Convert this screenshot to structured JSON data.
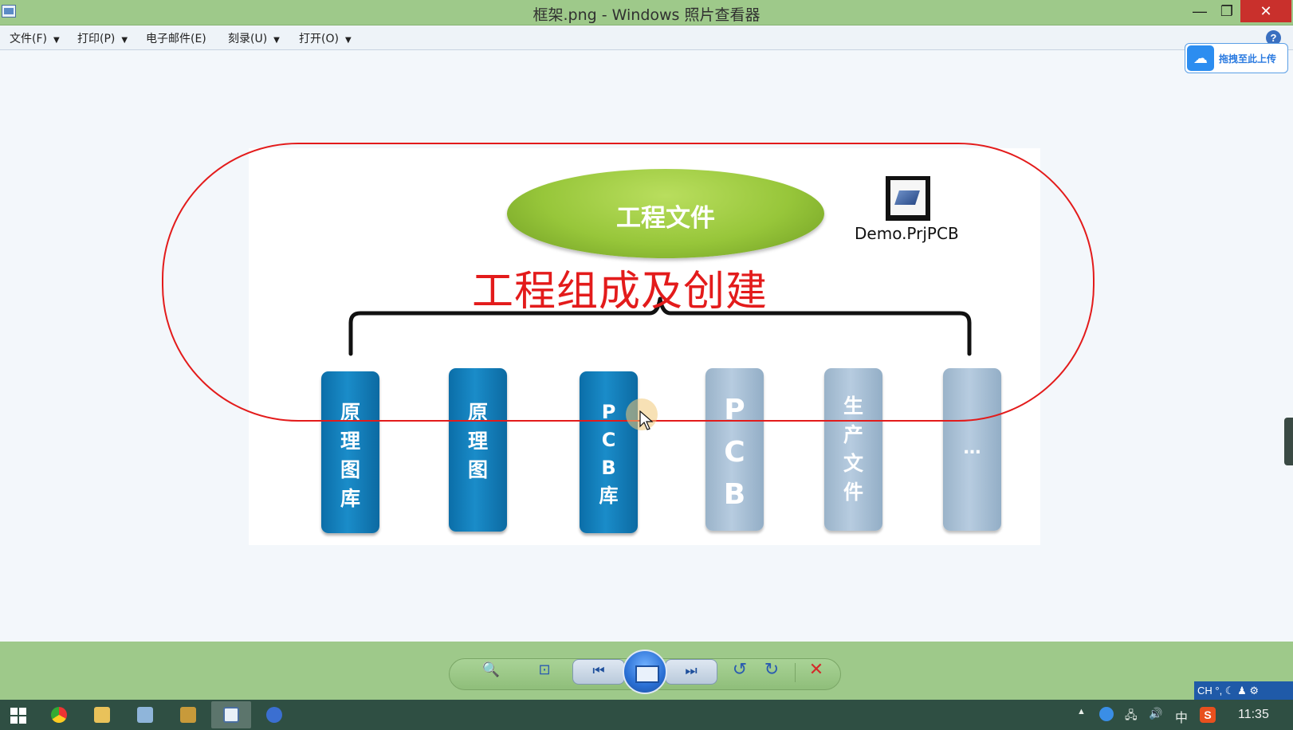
{
  "window": {
    "title": "框架.png - Windows 照片查看器",
    "minimize": "—",
    "maximize": "❐",
    "close": "✕"
  },
  "menu": {
    "file": "文件(F)",
    "print": "打印(P)",
    "email": "电子邮件(E)",
    "burn": "刻录(U)",
    "open": "打开(O)",
    "dropdown_arrow": "▼",
    "help": "?"
  },
  "upload_widget": {
    "icon": "cloud-icon",
    "label": "拖拽至此上传"
  },
  "slide": {
    "root_label": "工程文件",
    "file_label": "Demo.PrjPCB",
    "annotation": "工程组成及创建",
    "bars": [
      {
        "text": "原理图库",
        "style": "dark"
      },
      {
        "text": "原理图",
        "style": "dark"
      },
      {
        "text": "PCB库",
        "style": "dark"
      },
      {
        "text": "PCB",
        "style": "light"
      },
      {
        "text": "生产文件",
        "style": "light"
      },
      {
        "text": "…",
        "style": "light"
      }
    ]
  },
  "controls": {
    "zoom": "🔍",
    "fit": "⊡",
    "prev": "⏮",
    "next": "⏭",
    "rotate_ccw": "↺",
    "rotate_cw": "↻",
    "delete": "✕"
  },
  "ime": {
    "text": "CH °, ☾ ♟ ⚙"
  },
  "taskbar": {
    "tray_lang": "中",
    "time": "11:35"
  },
  "colors": {
    "titlebar": "#9ec98a",
    "annotation_red": "#e31b1b",
    "bar_dark": "#0b6ea8",
    "bar_light": "#9ab3c9",
    "ellipse_green": "#97c63a"
  }
}
